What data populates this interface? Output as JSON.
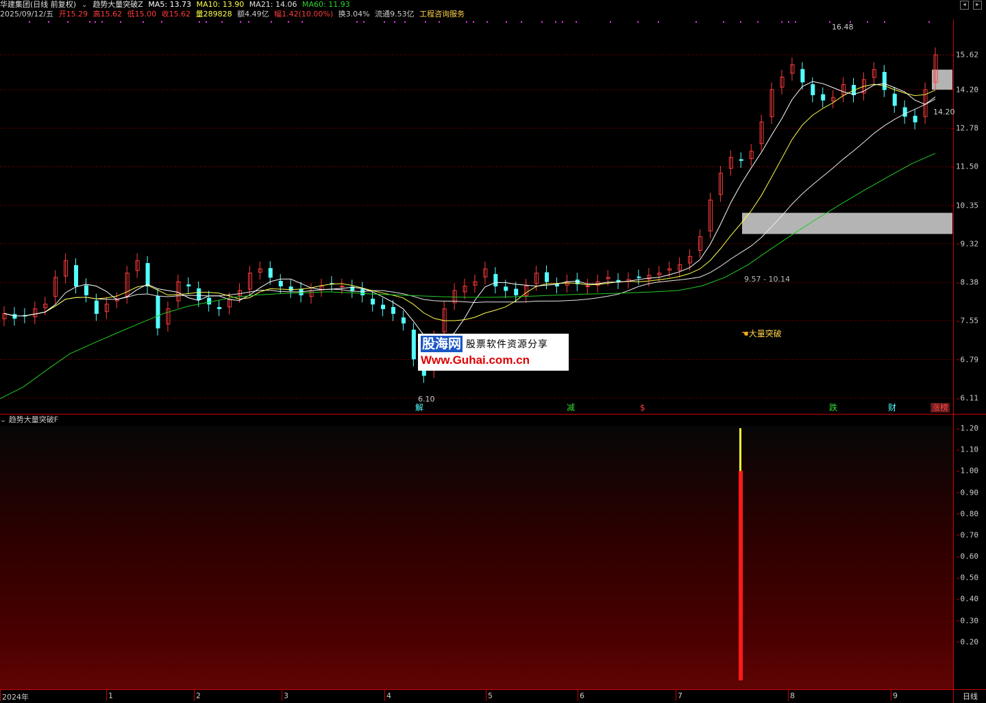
{
  "header": {
    "stock_name": "华建集团(日线 前复权)",
    "indicator_name": "趋势大量突破Z",
    "ma5": "MA5: 13.73",
    "ma10": "MA10: 13.90",
    "ma21": "MA21: 14.06",
    "ma60": "MA60: 11.93",
    "date": "2025/09/12/五",
    "open": "开15.29",
    "high": "高15.62",
    "low": "低15.00",
    "close": "收15.62",
    "volume": "量289828",
    "amount": "额4.49亿",
    "change": "幅1.42(10.00%)",
    "turnover": "换3.04%",
    "float": "流通9.53亿",
    "sector": "工程咨询服务"
  },
  "colors": {
    "up": "#ff3c3c",
    "down": "#54ffff",
    "ma5": "#ffffff",
    "ma10": "#ffff4a",
    "ma21": "#e8e8e8",
    "ma60": "#22cc22",
    "grid": "#c00000",
    "zone": "#b4b4b4",
    "marker": "#ff33ff"
  },
  "price_axis": [
    "15.62",
    "14.20",
    "12.78",
    "11.50",
    "10.35",
    "9.32",
    "8.38",
    "7.55",
    "6.79",
    "6.11"
  ],
  "sub_axis": [
    "1.20",
    "1.10",
    "1.00",
    "0.90",
    "0.80",
    "0.70",
    "0.60",
    "0.50",
    "0.40",
    "0.30",
    "0.20"
  ],
  "time_axis": [
    "2024年",
    "1",
    "2",
    "3",
    "4",
    "5",
    "6",
    "7",
    "8",
    "9"
  ],
  "annotations": {
    "high": "16.48",
    "low": "6.10",
    "current": "14.20",
    "zone_range": "9.57 - 10.14",
    "breakout": "大量突破"
  },
  "events": [
    {
      "text": "解",
      "color": "#54ffff"
    },
    {
      "text": "减",
      "color": "#33dd33"
    },
    {
      "text": "$",
      "color": "#ff3c3c"
    },
    {
      "text": "跌",
      "color": "#33dd33"
    },
    {
      "text": "财",
      "color": "#54ffff"
    },
    {
      "text": "涨榜",
      "color": "#ff4444"
    }
  ],
  "sub_panel": {
    "title": "趋势大量突破F",
    "signal_value": 1.0,
    "signal_top": 1.2
  },
  "watermark": {
    "logo": "股海网",
    "slogan": "股票软件资源分享",
    "url": "Www.Guhai.com.cn"
  },
  "period": "日线",
  "chart_data": {
    "type": "candlestick",
    "close_series": [
      7.7,
      7.6,
      7.65,
      7.8,
      7.9,
      8.5,
      8.9,
      8.3,
      8.1,
      7.7,
      7.9,
      8.0,
      8.6,
      8.9,
      8.3,
      7.4,
      7.8,
      8.4,
      8.3,
      8.0,
      7.9,
      7.8,
      8.0,
      8.2,
      8.6,
      8.7,
      8.5,
      8.3,
      8.2,
      8.1,
      8.2,
      8.3,
      8.35,
      8.3,
      8.2,
      8.1,
      7.9,
      7.8,
      7.7,
      7.5,
      6.8,
      6.5,
      7.2,
      7.8,
      8.2,
      8.3,
      8.4,
      8.7,
      8.3,
      8.2,
      8.1,
      8.3,
      8.6,
      8.4,
      8.3,
      8.4,
      8.35,
      8.3,
      8.4,
      8.5,
      8.4,
      8.45,
      8.5,
      8.55,
      8.6,
      8.7,
      8.8,
      9.0,
      9.5,
      10.5,
      11.3,
      11.8,
      11.7,
      12.0,
      13.0,
      14.2,
      14.7,
      15.2,
      14.5,
      14.0,
      13.8,
      13.9,
      14.4,
      14.0,
      14.6,
      15.0,
      14.2,
      13.6,
      13.2,
      13.0,
      14.2,
      15.62
    ],
    "ma60_series": [
      6.1,
      6.3,
      6.6,
      6.9,
      7.1,
      7.3,
      7.5,
      7.7,
      7.85,
      7.95,
      8.05,
      8.1,
      8.13,
      8.15,
      8.17,
      8.15,
      8.12,
      8.1,
      8.08,
      8.06,
      8.05,
      8.05,
      8.06,
      8.08,
      8.1,
      8.12,
      8.13,
      8.15,
      8.17,
      8.2,
      8.3,
      8.5,
      8.8,
      9.2,
      9.6,
      10.0,
      10.4,
      10.8,
      11.2,
      11.6,
      11.93
    ],
    "ylim": [
      6.1,
      16.48
    ],
    "x_range": [
      "2024年",
      "9"
    ],
    "volume_signal": {
      "value": 1.0,
      "ylim": [
        0,
        1.2
      ]
    }
  }
}
